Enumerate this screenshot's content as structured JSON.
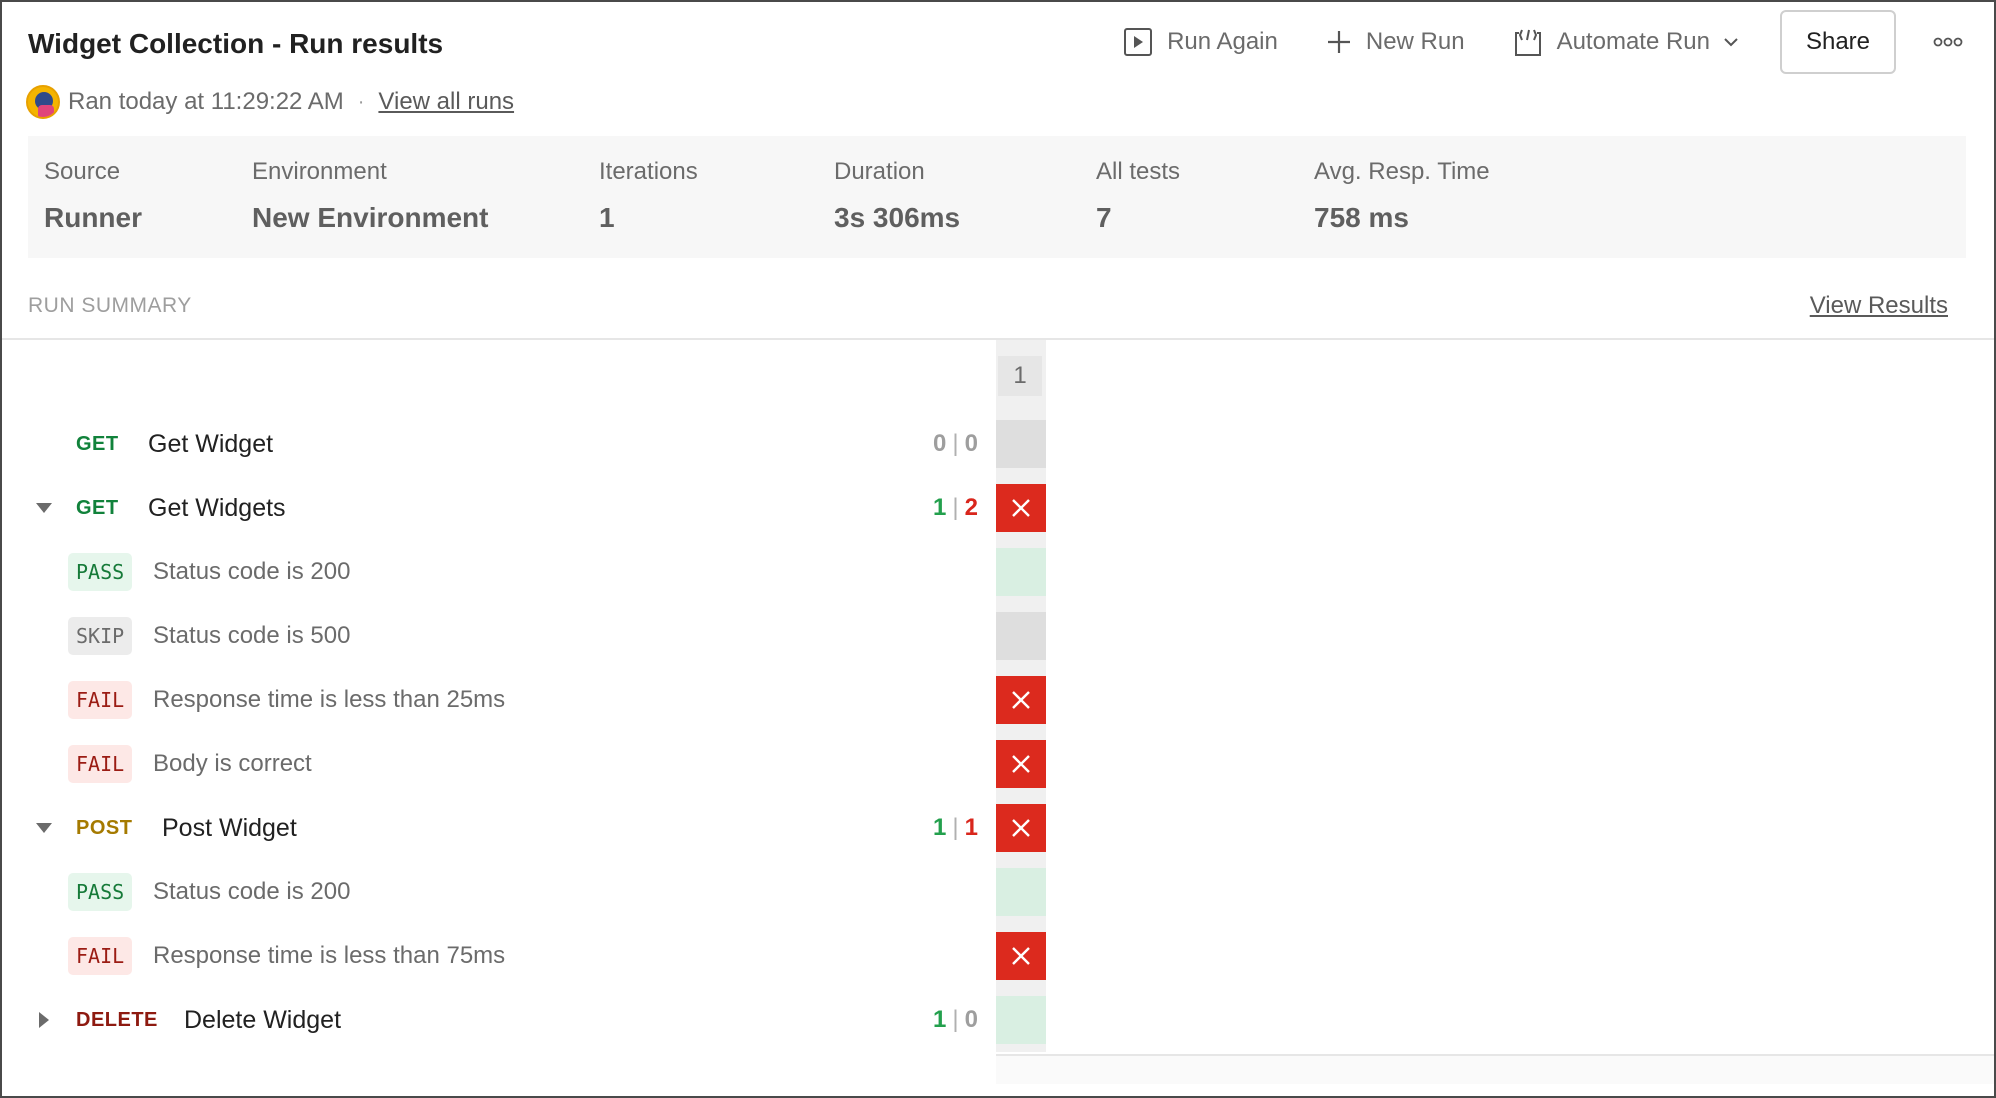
{
  "header": {
    "title": "Widget Collection - Run results",
    "ran_text": "Ran today at 11:29:22 AM",
    "separator": "·",
    "view_all_runs": "View all runs"
  },
  "toolbar": {
    "run_again": "Run Again",
    "new_run": "New Run",
    "automate_run": "Automate Run",
    "share": "Share"
  },
  "stats": [
    {
      "label": "Source",
      "value": "Runner"
    },
    {
      "label": "Environment",
      "value": "New Environment"
    },
    {
      "label": "Iterations",
      "value": "1"
    },
    {
      "label": "Duration",
      "value": "3s 306ms"
    },
    {
      "label": "All tests",
      "value": "7"
    },
    {
      "label": "Avg. Resp. Time",
      "value": "758 ms"
    }
  ],
  "summary": {
    "heading": "RUN SUMMARY",
    "view_results": "View Results",
    "iteration_label": "1"
  },
  "requests": [
    {
      "method": "GET",
      "name": "Get Widget",
      "pass": "0",
      "fail": "0",
      "cell": "skip"
    },
    {
      "method": "GET",
      "name": "Get Widgets",
      "pass": "1",
      "fail": "2",
      "cell": "fail",
      "tests": [
        {
          "status": "PASS",
          "name": "Status code is 200",
          "cell": "pass"
        },
        {
          "status": "SKIP",
          "name": "Status code is 500",
          "cell": "skip"
        },
        {
          "status": "FAIL",
          "name": "Response time is less than 25ms",
          "cell": "fail"
        },
        {
          "status": "FAIL",
          "name": "Body is correct",
          "cell": "fail"
        }
      ]
    },
    {
      "method": "POST",
      "name": "Post Widget",
      "pass": "1",
      "fail": "1",
      "cell": "fail",
      "tests": [
        {
          "status": "PASS",
          "name": "Status code is 200",
          "cell": "pass"
        },
        {
          "status": "FAIL",
          "name": "Response time is less than 75ms",
          "cell": "fail"
        }
      ]
    },
    {
      "method": "DELETE",
      "name": "Delete Widget",
      "pass": "1",
      "fail": "0",
      "cell": "pass"
    }
  ],
  "colors": {
    "get": "#11823b",
    "post": "#a57a00",
    "delete": "#8e1a10",
    "fail_cell": "#dc2a1e",
    "pass_cell": "#d9efe2"
  }
}
